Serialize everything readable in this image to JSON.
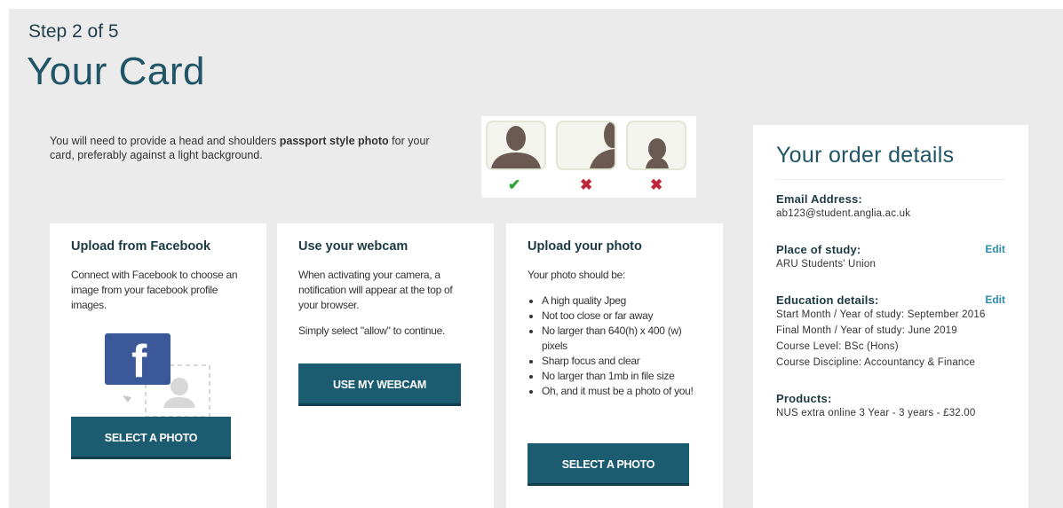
{
  "header": {
    "step": "Step 2 of 5",
    "title": "Your Card"
  },
  "intro": {
    "before": "You will need to provide a head and shoulders ",
    "bold": "passport style photo",
    "after": " for your card, preferably against a light background."
  },
  "examples": {
    "marks": [
      "✔",
      "✖",
      "✖"
    ]
  },
  "facebook": {
    "heading": "Upload from Facebook",
    "text": "Connect with Facebook to choose an image from your facebook profile images.",
    "button": "SELECT A PHOTO",
    "logo_letter": "f"
  },
  "webcam": {
    "heading": "Use your webcam",
    "text": "When activating your camera, a notification will appear at the top of your browser.",
    "text2": "Simply select \"allow\" to continue.",
    "button": "USE MY WEBCAM"
  },
  "upload": {
    "heading": "Upload your photo",
    "intro": "Your photo should be:",
    "requirements": [
      "A high quality Jpeg",
      "Not too close or far away",
      "No larger than 640(h) x 400 (w) pixels",
      "Sharp focus and clear",
      "No larger than 1mb in file size",
      "Oh, and it must be a photo of you!"
    ],
    "button": "SELECT A PHOTO"
  },
  "order": {
    "title": "Your order details",
    "edit_label": "Edit",
    "email_label": "Email Address:",
    "email": "ab123@student.anglia.ac.uk",
    "place_label": "Place of study:",
    "place": "ARU Students' Union",
    "education_label": "Education details:",
    "education": [
      "Start Month / Year of study: September 2016",
      "Final Month / Year of study: June 2019",
      "Course Level: BSc (Hons)",
      "Course Discipline: Accountancy & Finance"
    ],
    "products_label": "Products:",
    "product": "NUS extra online 3 Year - 3 years - £32.00"
  },
  "colors": {
    "accent": "#1c5c71",
    "title": "#1f5566",
    "ok": "#2ea53a",
    "bad": "#c0263a",
    "facebook": "#3b5998"
  }
}
